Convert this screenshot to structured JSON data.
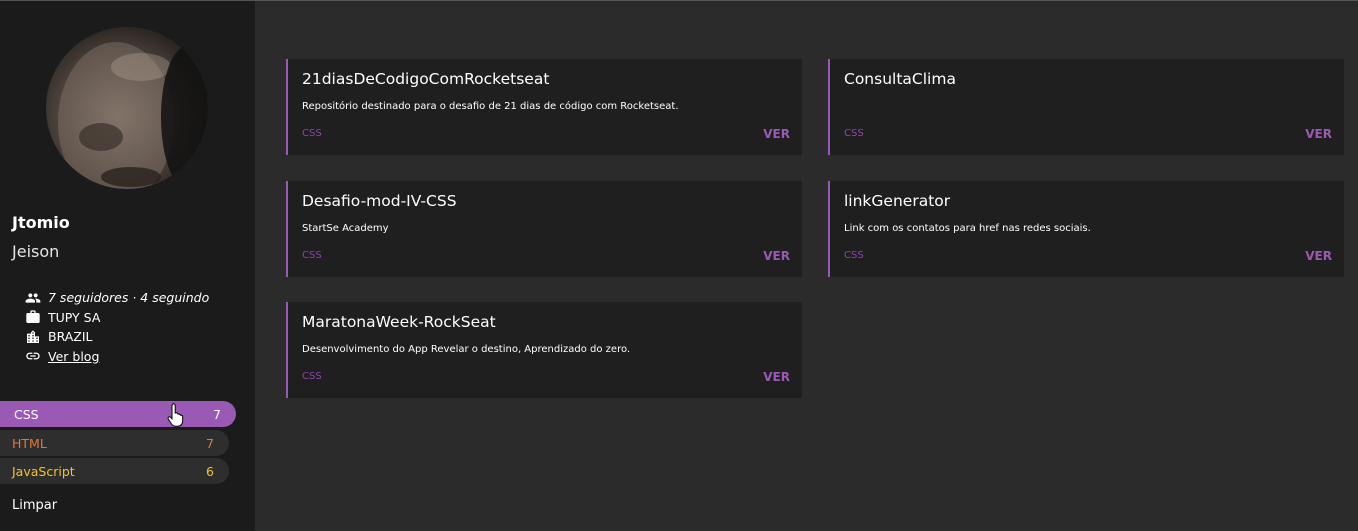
{
  "profile": {
    "login": "Jtomio",
    "name": "Jeison",
    "followers_text": "7 seguidores · 4 seguindo",
    "company": "TUPY SA",
    "location": "BRAZIL",
    "blog_label": "Ver blog"
  },
  "languages": [
    {
      "label": "CSS",
      "count": "7",
      "color": "#9b59b6"
    },
    {
      "label": "HTML",
      "count": "7",
      "color": "#e8772e"
    },
    {
      "label": "JavaScript",
      "count": "6",
      "color": "#f0c330"
    }
  ],
  "clear_label": "Limpar",
  "repos": [
    {
      "name": "21diasDeCodigoComRocketseat",
      "description": "Repositório destinado para o desafio de 21 dias de código com Rocketseat.",
      "language": "CSS",
      "link_label": "VER"
    },
    {
      "name": "ConsultaClima",
      "description": "",
      "language": "CSS",
      "link_label": "VER"
    },
    {
      "name": "Desafio-mod-IV-CSS",
      "description": "StartSe Academy",
      "language": "CSS",
      "link_label": "VER"
    },
    {
      "name": "linkGenerator",
      "description": "Link com os contatos para href nas redes sociais.",
      "language": "CSS",
      "link_label": "VER"
    },
    {
      "name": "MaratonaWeek-RockSeat",
      "description": "Desenvolvimento do App Revelar o destino, Aprendizado do zero.",
      "language": "CSS",
      "link_label": "VER"
    }
  ],
  "colors": {
    "accent": "#9b59b6",
    "sidebar_bg": "#1b1b1b",
    "main_bg": "#2b2b2b",
    "card_bg": "#1f1f1f"
  },
  "icons": [
    "people-icon",
    "briefcase-icon",
    "building-icon",
    "link-icon",
    "hand-cursor-icon"
  ]
}
